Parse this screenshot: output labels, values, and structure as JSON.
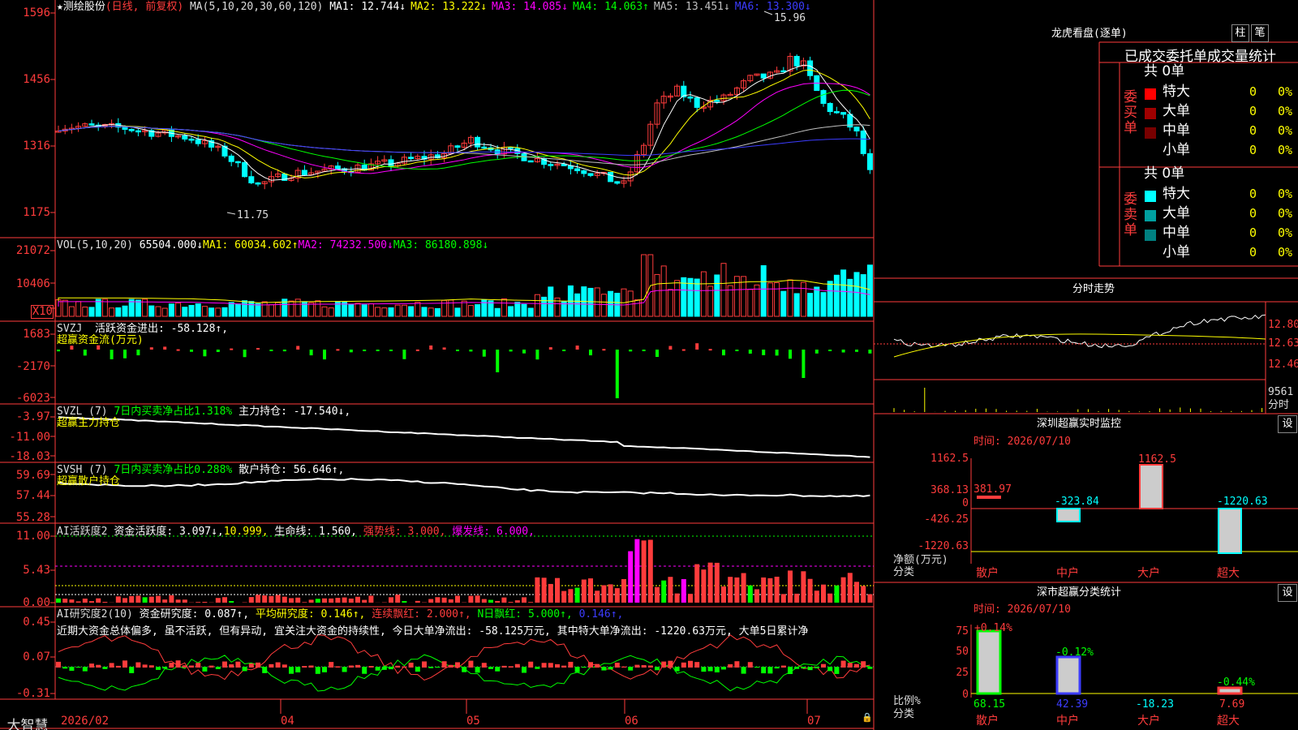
{
  "app": {
    "brand": "大智慧"
  },
  "kline": {
    "header": {
      "star": "★",
      "name": "测绘股份",
      "mode": "(日线, 前复权)",
      "ma_label": "MA(5,10,20,30,60,120)",
      "ma": [
        {
          "t": "MA1: 12.744↓",
          "c": "#ffffff"
        },
        {
          "t": "MA2: 13.222↓",
          "c": "#ffff00"
        },
        {
          "t": "MA3: 14.085↓",
          "c": "#ff00ff"
        },
        {
          "t": "MA4: 14.063↑",
          "c": "#00ff00"
        },
        {
          "t": "MA5: 13.451↓",
          "c": "#c0c0c0"
        },
        {
          "t": "MA6: 13.300↓",
          "c": "#3c3cff"
        }
      ]
    },
    "y_labels": [
      "1596",
      "1456",
      "1316",
      "1175"
    ],
    "high_label": "15.96",
    "low_label": "11.75"
  },
  "volume": {
    "header": {
      "name": "VOL(5,10,20)",
      "value": "65504.000↓",
      "ma1": "MA1: 60034.602↑",
      "ma2": "MA2: 74232.500↓",
      "ma3": "MA3: 86180.898↓"
    },
    "y_labels": [
      "21072",
      "10406",
      "X10"
    ]
  },
  "svzj": {
    "name": "SVZJ",
    "title": "活跃资金进出: -58.128↑,",
    "sub": "超赢资金流(万元)",
    "y_labels": [
      "1683",
      "-2170",
      "-6023"
    ]
  },
  "svzl": {
    "name": "SVZL (7)",
    "ratio": "7日内买卖净占比1.318%",
    "title": "主力持仓: -17.540↓,",
    "sub": "超赢主力持仓",
    "y_labels": [
      "-3.97",
      "-11.00",
      "-18.03"
    ]
  },
  "svsh": {
    "name": "SVSH (7)",
    "ratio": "7日内买卖净占比0.288%",
    "title": "散户持仓: 56.646↑,",
    "sub": "超赢散户持仓",
    "y_labels": [
      "59.69",
      "57.44",
      "55.28"
    ]
  },
  "ai1": {
    "name": "AI活跃度2",
    "t1": "资金活跃度: 3.097↓,",
    "t2": "10.999,",
    "t3": "生命线: 1.560,",
    "t4": "强势线: 3.000,",
    "t5": "爆发线: 6.000,",
    "y_labels": [
      "11.00",
      "5.43",
      "0.00"
    ]
  },
  "ai2": {
    "name": "AI研究度2(10)",
    "t1": "资金研究度: 0.087↑,",
    "t2": "平均研究度: 0.146↑,",
    "t3": "连续飘红: 2.000↑,",
    "t4": "N日飘红: 5.000↑,",
    "t5": "0.146↑,",
    "comment": "近期大资金总体偏多, 虽不活跃, 但有异动, 宜关注大资金的持续性, 今日大单净流出: -58.125万元, 其中特大单净流出: -1220.63万元, 大单5日累计净",
    "y_labels": [
      "0.45",
      "0.07",
      "-0.31"
    ]
  },
  "x_axis": [
    "2026/02",
    "04",
    "05",
    "06",
    "07"
  ],
  "right": {
    "lhb": {
      "title": "龙虎看盘(逐单)",
      "btn1": "柱",
      "btn2": "笔",
      "header": "已成交委托单成交量统计",
      "buy": {
        "side": "委买单",
        "total": "共 0单",
        "rows": [
          {
            "label": "特大",
            "v": "0",
            "p": "0%",
            "c": "#ff0000"
          },
          {
            "label": "大单",
            "v": "0",
            "p": "0%",
            "c": "#a00000"
          },
          {
            "label": "中单",
            "v": "0",
            "p": "0%",
            "c": "#780000"
          },
          {
            "label": "小单",
            "v": "0",
            "p": "0%",
            "c": ""
          }
        ]
      },
      "sell": {
        "side": "委卖单",
        "total": "共 0单",
        "rows": [
          {
            "label": "特大",
            "v": "0",
            "p": "0%",
            "c": "#00ffff"
          },
          {
            "label": "大单",
            "v": "0",
            "p": "0%",
            "c": "#00a0a0"
          },
          {
            "label": "中单",
            "v": "0",
            "p": "0%",
            "c": "#008080"
          },
          {
            "label": "小单",
            "v": "0",
            "p": "0%",
            "c": ""
          }
        ]
      }
    },
    "intraday": {
      "title": "分时走势",
      "y": [
        "12.80",
        "12.63",
        "12.46"
      ],
      "vol": "9561",
      "vol_unit": "分时"
    },
    "sz_monitor": {
      "title": "深圳超赢实时监控",
      "btn": "设",
      "date": "时间: 2026/07/10",
      "y": [
        "1162.5",
        "368.13",
        "0",
        "-426.25",
        "-1220.63"
      ],
      "y_unit1": "净额(万元)",
      "y_unit2": "分类",
      "cats": [
        "散户",
        "中户",
        "大户",
        "超大"
      ],
      "vals": [
        "381.97",
        "-323.84",
        "1162.5",
        "-1220.63"
      ]
    },
    "sz_class": {
      "title": "深市超赢分类统计",
      "btn": "设",
      "date": "时间: 2026/07/10",
      "y": [
        "75",
        "50",
        "25",
        "0"
      ],
      "y_unit1": "比例%",
      "y_unit2": "分类",
      "cats": [
        "散户",
        "中户",
        "大户",
        "超大"
      ],
      "pcts": [
        "+0.14%",
        "-0.12%",
        "",
        "-0.44%"
      ],
      "vals": [
        "68.15",
        "42.39",
        "-18.23",
        "7.69"
      ]
    }
  }
}
